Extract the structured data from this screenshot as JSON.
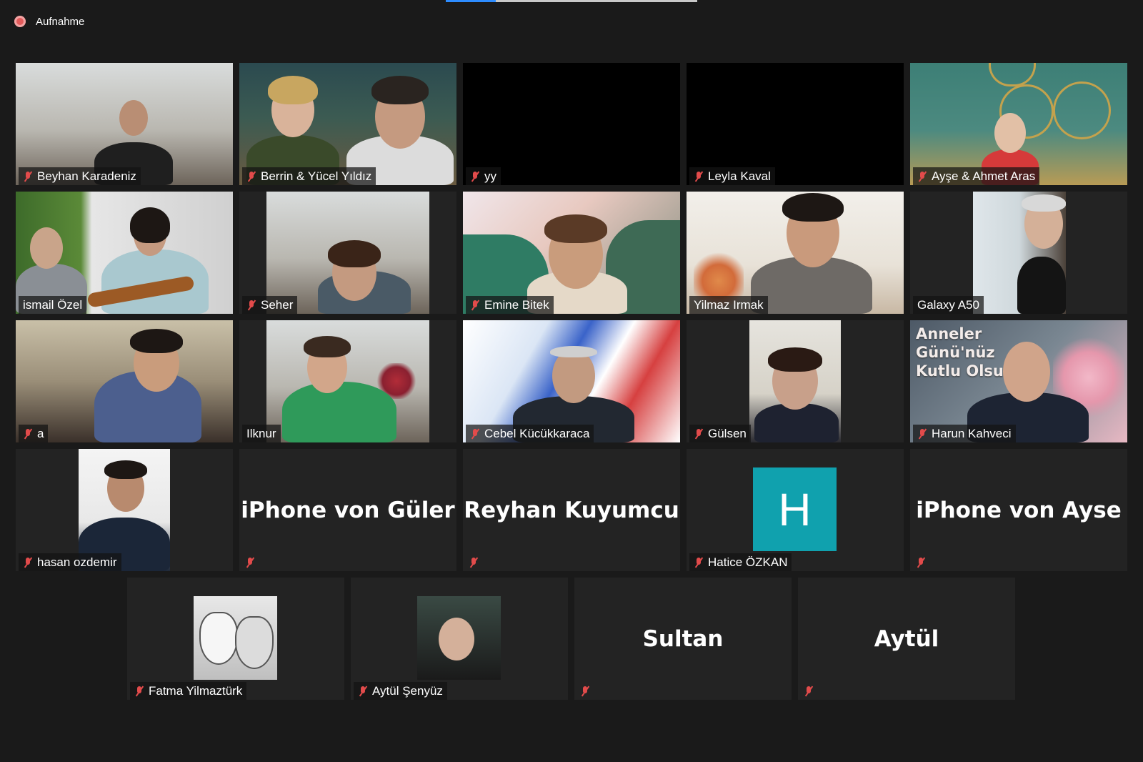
{
  "recording": {
    "label": "Aufnahme"
  },
  "poster": {
    "text": "Anneler\nGünü'nüz\nKutlu Olsun"
  },
  "participants": [
    {
      "name": "Beyhan Karadeniz",
      "muted": true
    },
    {
      "name": "Berrin & Yücel Yıldız",
      "muted": true
    },
    {
      "name": "yy",
      "muted": true
    },
    {
      "name": "Leyla Kaval",
      "muted": true
    },
    {
      "name": "Ayşe & Ahmet  Aras",
      "muted": true
    },
    {
      "name": "ismail Özel",
      "muted": false
    },
    {
      "name": "Seher",
      "muted": true
    },
    {
      "name": "Emine Bitek",
      "muted": true
    },
    {
      "name": "Yilmaz Irmak",
      "muted": false
    },
    {
      "name": "Galaxy A50",
      "muted": false
    },
    {
      "name": "a",
      "muted": true
    },
    {
      "name": "Ilknur",
      "muted": false
    },
    {
      "name": "Cebel Kücükkaraca",
      "muted": true
    },
    {
      "name": "Gülsen",
      "muted": true
    },
    {
      "name": "Harun Kahveci",
      "muted": true
    },
    {
      "name": "hasan ozdemir",
      "muted": true
    },
    {
      "name": "iPhone von Güler",
      "muted": true
    },
    {
      "name": "Reyhan Kuyumcu",
      "muted": true
    },
    {
      "name": "Hatice ÖZKAN",
      "muted": true,
      "avatar_letter": "H",
      "avatar_color": "#10a1ae"
    },
    {
      "name": "iPhone von Ayse",
      "muted": true
    },
    {
      "name": "Fatma Yilmaztürk",
      "muted": true
    },
    {
      "name": "Aytül Şenyüz",
      "muted": true
    },
    {
      "name": "Sultan",
      "muted": true
    },
    {
      "name": "Aytül",
      "muted": true
    }
  ],
  "colors": {
    "background": "#1a1a1a",
    "active_speaker": "#e1eb4a",
    "muted_icon": "#e24b4b"
  }
}
